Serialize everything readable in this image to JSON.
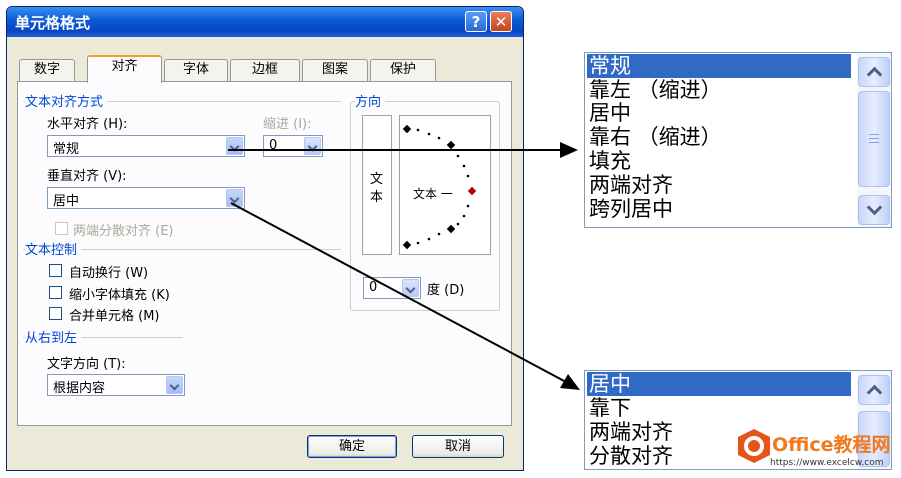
{
  "dialog": {
    "title": "单元格格式",
    "help_label": "?",
    "close_label": "✕",
    "tabs": [
      {
        "label": "数字"
      },
      {
        "label": "对齐"
      },
      {
        "label": "字体"
      },
      {
        "label": "边框"
      },
      {
        "label": "图案"
      },
      {
        "label": "保护"
      }
    ],
    "alignment": {
      "title": "文本对齐方式",
      "horizontal_label": "水平对齐 (H):",
      "horizontal_value": "常规",
      "indent_label": "缩进 (I):",
      "indent_value": "0",
      "vertical_label": "垂直对齐 (V):",
      "vertical_value": "居中",
      "distributed_label": "两端分散对齐 (E)"
    },
    "text_control": {
      "title": "文本控制",
      "wrap_label": "自动换行 (W)",
      "shrink_label": "缩小字体填充 (K)",
      "merge_label": "合并单元格 (M)"
    },
    "rtl": {
      "title": "从右到左",
      "direction_label": "文字方向 (T):",
      "direction_value": "根据内容"
    },
    "orientation": {
      "title": "方向",
      "vertical_text_1": "文",
      "vertical_text_2": "本",
      "dial_text": "文本 一",
      "degree_value": "0",
      "degree_label": "度 (D)"
    },
    "ok_label": "确定",
    "cancel_label": "取消"
  },
  "horizontal_dropdown": {
    "items": [
      "常规",
      "靠左 （缩进）",
      "居中",
      "靠右 （缩进）",
      "填充",
      "两端对齐",
      "跨列居中"
    ],
    "selected": "常规"
  },
  "vertical_dropdown": {
    "items": [
      "居中",
      "靠下",
      "两端对齐",
      "分散对齐"
    ],
    "selected": "居中"
  },
  "watermark": {
    "brand": "Office教程网",
    "url": "https://www.excelcw.com"
  },
  "colors": {
    "titlebar": "#0a5ad6",
    "selection": "#316ac5",
    "group_title": "#0046d5",
    "dialog_bg": "#ece9d8"
  }
}
